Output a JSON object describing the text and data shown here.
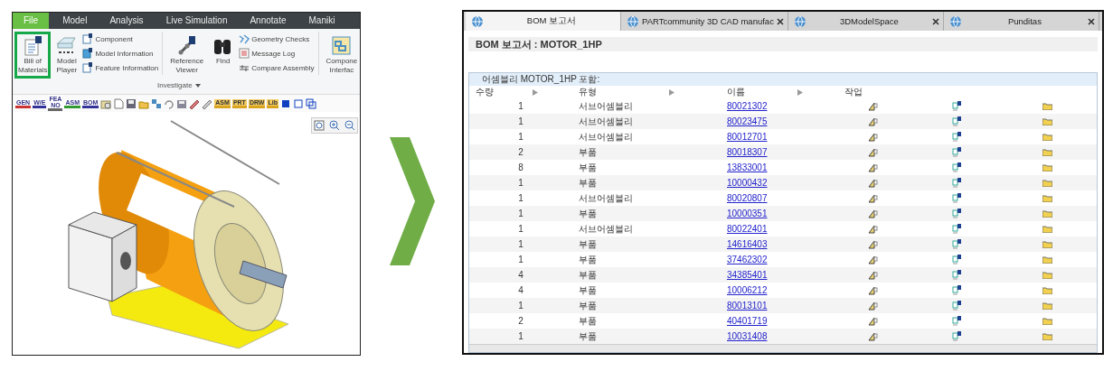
{
  "cad_window": {
    "menu_tabs": [
      {
        "label": "File",
        "selected": true
      },
      {
        "label": "Model",
        "selected": false
      },
      {
        "label": "Analysis",
        "selected": false
      },
      {
        "label": "Live Simulation",
        "selected": false
      },
      {
        "label": "Annotate",
        "selected": false
      },
      {
        "label": "Maniki",
        "selected": false
      }
    ],
    "ribbon": {
      "columns": [
        {
          "kind": "large",
          "label": "Bill of\nMaterials",
          "highlighted": true
        },
        {
          "kind": "large",
          "label": "Model\nPlayer",
          "highlighted": false
        },
        {
          "kind": "stack",
          "items": [
            "Component",
            "Model Information",
            "Feature Information"
          ]
        },
        {
          "kind": "separator"
        },
        {
          "kind": "large",
          "label": "Reference\nViewer",
          "highlighted": false
        },
        {
          "kind": "large",
          "label": "Find",
          "highlighted": false
        },
        {
          "kind": "stack",
          "items": [
            "Geometry Checks",
            "Message Log",
            "Compare Assembly"
          ]
        },
        {
          "kind": "separator"
        },
        {
          "kind": "large",
          "label": "Compone\nInterfac",
          "highlighted": false
        }
      ],
      "group_label": "Investigate"
    },
    "toolbar_tags_left": [
      "GEN",
      "W/E",
      "FEA\nNO",
      "ASM",
      "BOM"
    ],
    "toolbar_tags_right": [
      "ASM",
      "PRT",
      "DRW",
      "Lib"
    ]
  },
  "bom_window": {
    "tabs": [
      {
        "label": "BOM 보고서",
        "selected": true,
        "closable": false
      },
      {
        "label": "PARTcommunity 3D CAD manufac",
        "selected": false,
        "closable": true
      },
      {
        "label": "3DModelSpace",
        "selected": false,
        "closable": true
      },
      {
        "label": "Punditas",
        "selected": false,
        "closable": true
      }
    ],
    "title": "BOM 보고서 : MOTOR_1HP",
    "section_title": "어셈블리 MOTOR_1HP 포함:",
    "columns": [
      {
        "label": "수량",
        "sortable": true
      },
      {
        "label": "유형",
        "sortable": true
      },
      {
        "label": "이름",
        "sortable": true
      },
      {
        "label": "작업",
        "sortable": false
      }
    ],
    "rows": [
      {
        "quantity": "1",
        "type": "서브어셈블리",
        "name": "80021302"
      },
      {
        "quantity": "1",
        "type": "서브어셈블리",
        "name": "80023475"
      },
      {
        "quantity": "1",
        "type": "서브어셈블리",
        "name": "80012701"
      },
      {
        "quantity": "2",
        "type": "부품",
        "name": "80018307"
      },
      {
        "quantity": "8",
        "type": "부품",
        "name": "13833001"
      },
      {
        "quantity": "1",
        "type": "부품",
        "name": "10000432"
      },
      {
        "quantity": "1",
        "type": "서브어셈블리",
        "name": "80020807"
      },
      {
        "quantity": "1",
        "type": "부품",
        "name": "10000351"
      },
      {
        "quantity": "1",
        "type": "서브어셈블리",
        "name": "80022401"
      },
      {
        "quantity": "1",
        "type": "부품",
        "name": "14616403"
      },
      {
        "quantity": "1",
        "type": "부품",
        "name": "37462302"
      },
      {
        "quantity": "4",
        "type": "부품",
        "name": "34385401"
      },
      {
        "quantity": "4",
        "type": "부품",
        "name": "10006212"
      },
      {
        "quantity": "1",
        "type": "부품",
        "name": "80013101"
      },
      {
        "quantity": "2",
        "type": "부품",
        "name": "40401719"
      },
      {
        "quantity": "1",
        "type": "부품",
        "name": "10031408"
      }
    ]
  }
}
